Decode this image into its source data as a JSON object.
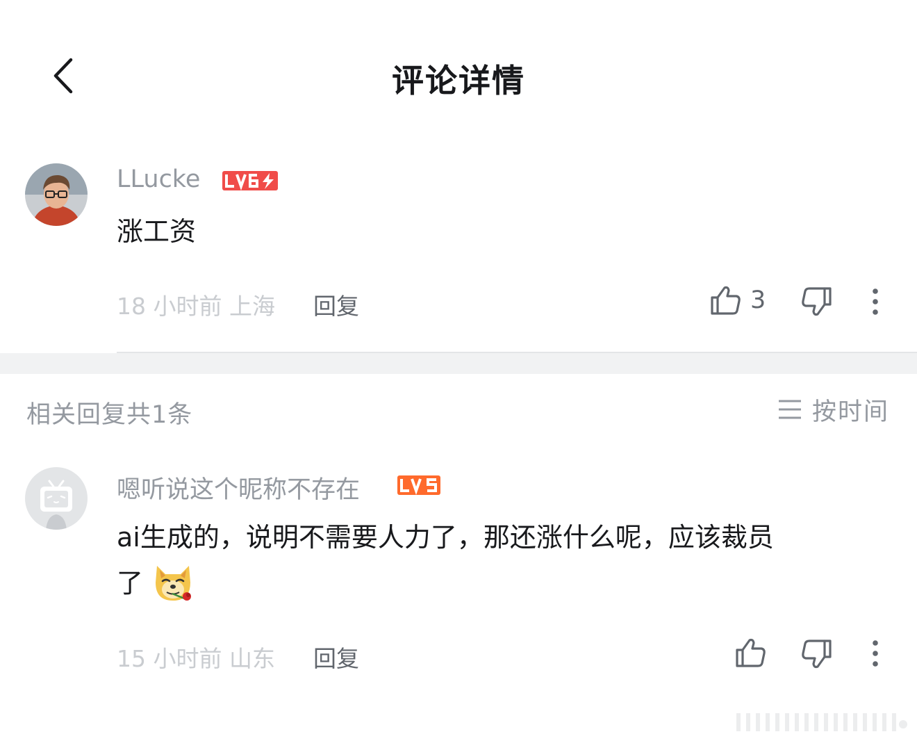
{
  "header": {
    "title": "评论详情"
  },
  "main_comment": {
    "username": "LLucke",
    "level": "LV6",
    "text": "涨工资",
    "time_location": "18 小时前 上海",
    "reply_label": "回复",
    "like_count": "3"
  },
  "replies_section": {
    "count_label": "相关回复共1条",
    "sort_label": "按时间"
  },
  "replies": [
    {
      "username": "嗯听说这个昵称不存在",
      "level": "LV5",
      "text_line1": "ai生成的，说明不需要人力了，那还涨什么呢，应该裁员",
      "text_line2": "了",
      "time_location": "15 小时前 山东",
      "reply_label": "回复"
    }
  ],
  "colors": {
    "lv6_badge": "#f04c49",
    "lv5_badge": "#ff6a2c",
    "muted_text": "#9499a0",
    "faint_text": "#c9ccd0",
    "icon": "#61666d",
    "gap_bg": "#f1f2f3"
  },
  "icons": {
    "back": "chevron-left-icon",
    "like": "thumbs-up-icon",
    "dislike": "thumbs-down-icon",
    "more": "more-vertical-icon",
    "sort": "menu-lines-icon"
  }
}
